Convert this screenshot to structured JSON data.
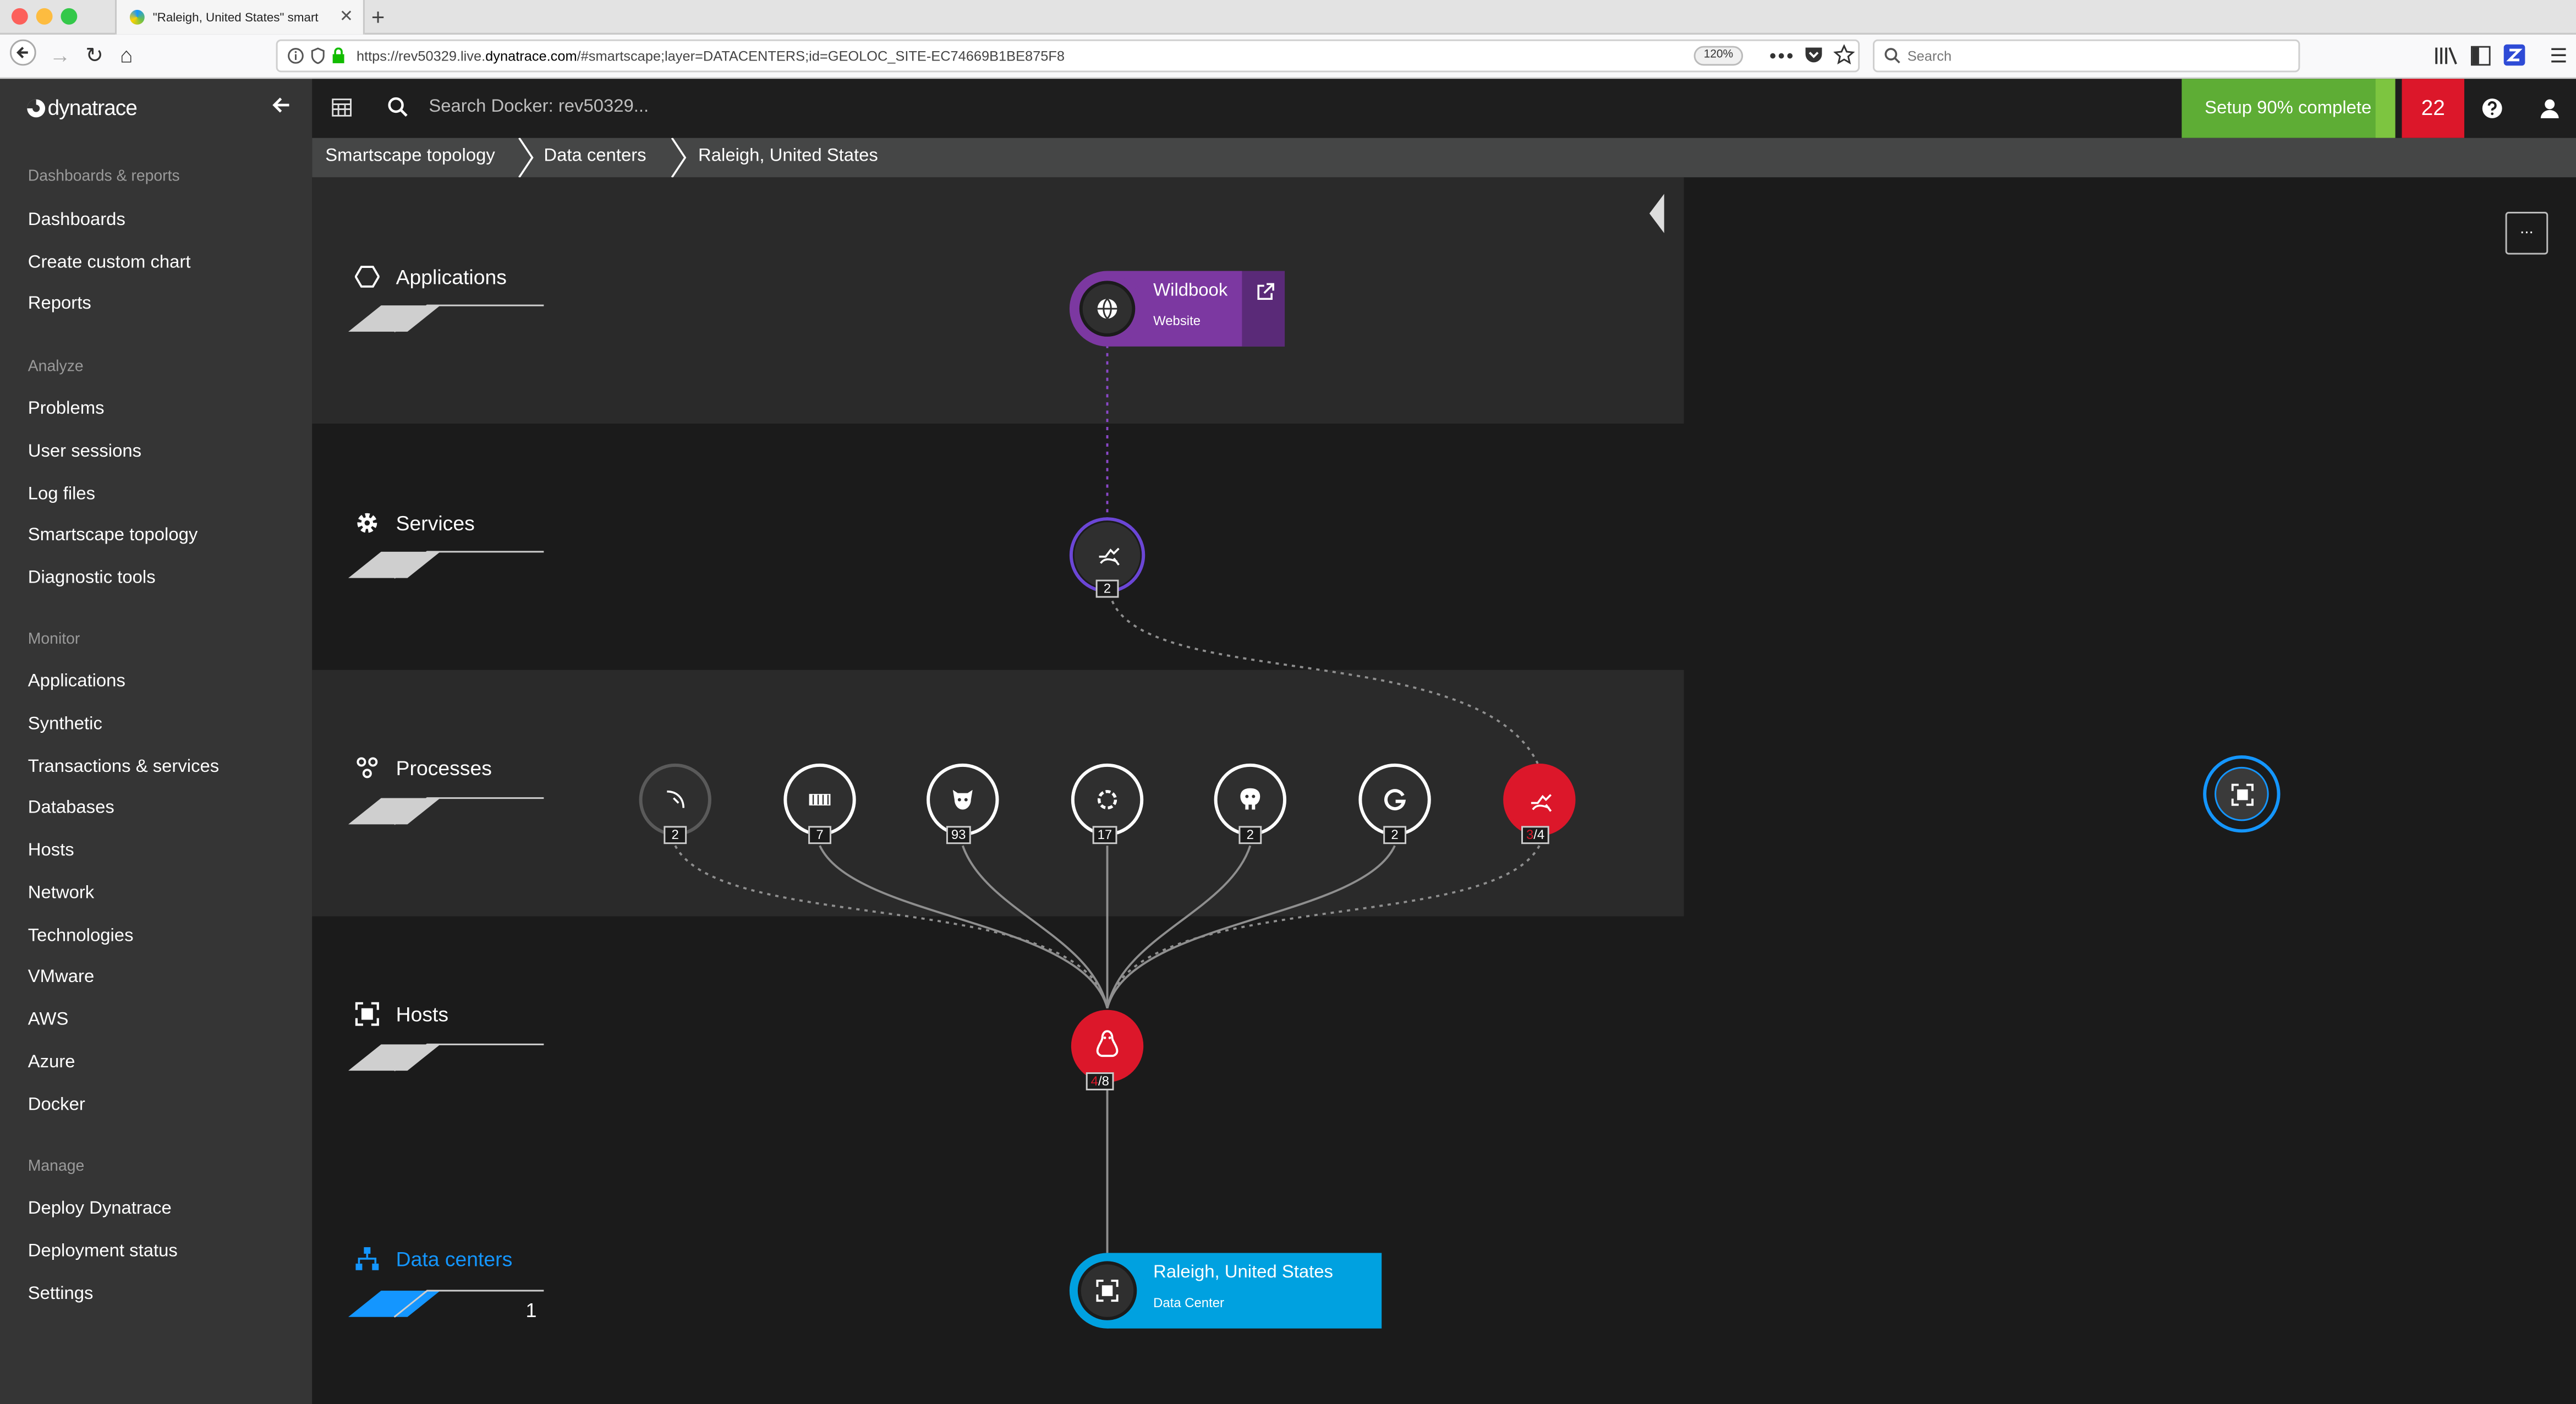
{
  "browser": {
    "tab_title": "\"Raleigh, United States\" smart",
    "url_prefix": "https://rev50329.live.",
    "url_domain": "dynatrace.com",
    "url_suffix": "/#smartscape;layer=DATACENTERS;id=GEOLOC_SITE-EC74669B1BE875F8",
    "zoom": "120%",
    "search_placeholder": "Search"
  },
  "sidebar": {
    "logo": "dynatrace",
    "groups": [
      {
        "heading": "Dashboards & reports",
        "items": [
          "Dashboards",
          "Create custom chart",
          "Reports"
        ]
      },
      {
        "heading": "Analyze",
        "items": [
          "Problems",
          "User sessions",
          "Log files",
          "Smartscape topology",
          "Diagnostic tools"
        ]
      },
      {
        "heading": "Monitor",
        "items": [
          "Applications",
          "Synthetic",
          "Transactions & services",
          "Databases",
          "Hosts",
          "Network",
          "Technologies",
          "VMware",
          "AWS",
          "Azure",
          "Docker"
        ]
      },
      {
        "heading": "Manage",
        "items": [
          "Deploy Dynatrace",
          "Deployment status",
          "Settings"
        ]
      }
    ]
  },
  "topbar": {
    "search_placeholder": "Search Docker: rev50329...",
    "setup_label": "Setup 90% complete",
    "problem_count": "22"
  },
  "breadcrumb": [
    "Smartscape topology",
    "Data centers",
    "Raleigh, United States"
  ],
  "menu_button": "...",
  "layers": {
    "applications": "Applications",
    "services": "Services",
    "processes": "Processes",
    "hosts": "Hosts",
    "datacenters": "Data centers",
    "datacenters_count": "1"
  },
  "application_node": {
    "name": "Wildbook",
    "type": "Website"
  },
  "service_node": {
    "count": "2"
  },
  "process_nodes": [
    {
      "icon": "unknown-process-icon",
      "count": "2",
      "problem": ""
    },
    {
      "icon": "memory-process-icon",
      "count": "7",
      "problem": ""
    },
    {
      "icon": "tomcat-process-icon",
      "count": "93",
      "problem": ""
    },
    {
      "icon": "generic-process-icon",
      "count": "17",
      "problem": ""
    },
    {
      "icon": "postgres-process-icon",
      "count": "2",
      "problem": ""
    },
    {
      "icon": "go-process-icon",
      "count": "2",
      "problem": ""
    },
    {
      "icon": "webserver-process-icon",
      "count": "/4",
      "problem": "3"
    }
  ],
  "host_node": {
    "problem": "4",
    "count": "/8"
  },
  "datacenter_node": {
    "name": "Raleigh, United States",
    "type": "Data Center"
  },
  "colors": {
    "accent": "#1496ff",
    "problem": "#dc172a",
    "application": "#7c38a1",
    "setup": "#5ead35"
  }
}
